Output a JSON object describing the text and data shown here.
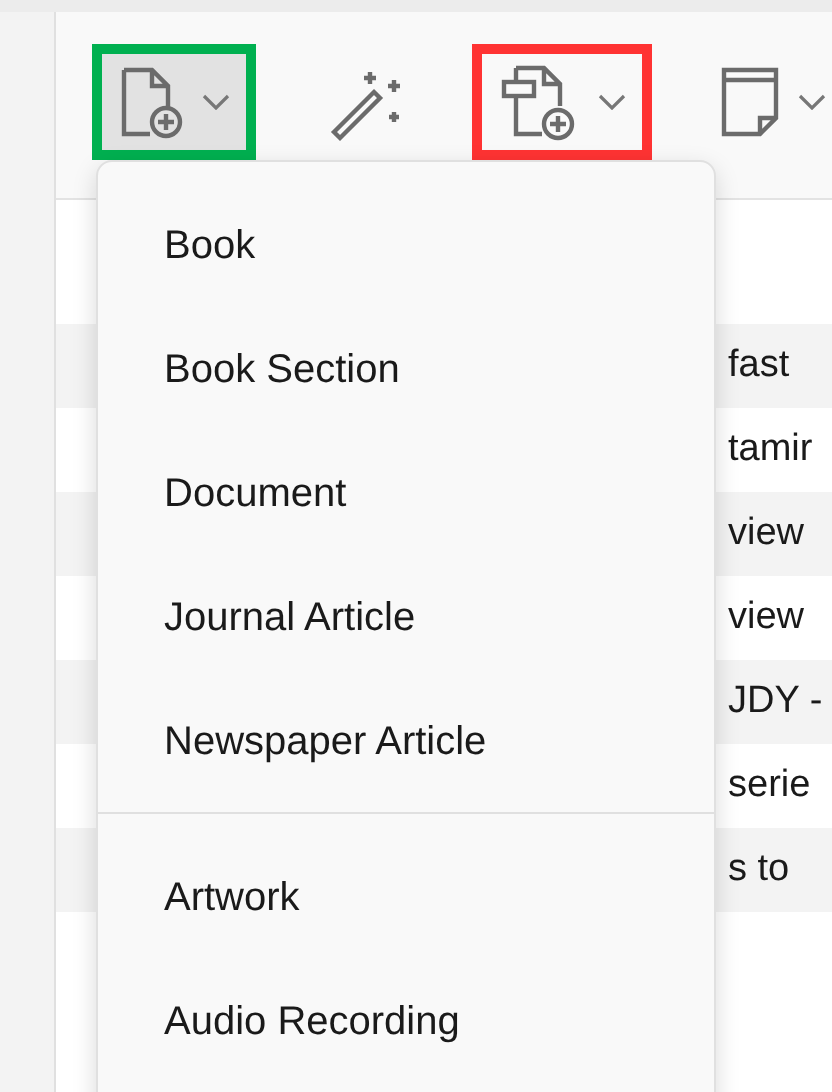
{
  "toolbar": {
    "buttons": [
      {
        "kind": "new-item",
        "dropdown": true,
        "color": "#00b050"
      },
      {
        "kind": "wand",
        "dropdown": false
      },
      {
        "kind": "new-from-file",
        "dropdown": true,
        "color": "#ff3333"
      },
      {
        "kind": "note",
        "dropdown": true
      }
    ]
  },
  "menu": {
    "groups": [
      [
        "Book",
        "Book Section",
        "Document",
        "Journal Article",
        "Newspaper Article"
      ],
      [
        "Artwork",
        "Audio Recording"
      ]
    ]
  },
  "list": {
    "rows": [
      {
        "text": "fast",
        "selected": false
      },
      {
        "text": "tamir",
        "selected": false
      },
      {
        "text": "view",
        "selected": false
      },
      {
        "text": "view",
        "selected": false
      },
      {
        "text": "JDY -",
        "selected": false
      },
      {
        "text": "serie",
        "selected": false
      },
      {
        "text": "s to",
        "selected": false
      }
    ]
  }
}
